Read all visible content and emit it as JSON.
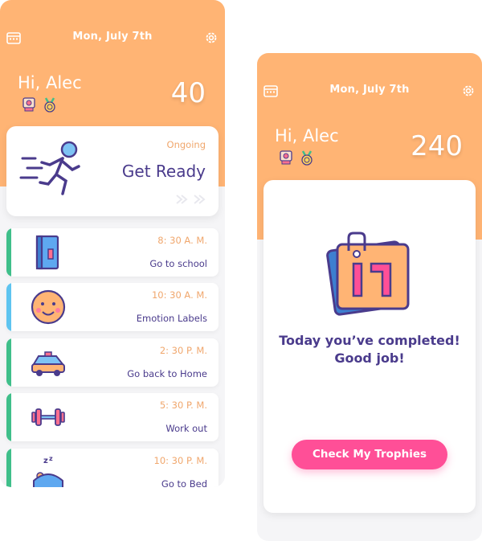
{
  "left_screen": {
    "date": "Mon, July 7th",
    "greeting": "Hi, Alec",
    "points": "40",
    "current_card": {
      "status": "Ongoing",
      "title": "Get Ready"
    },
    "tasks": [
      {
        "time": "8: 30 A. M.",
        "title": "Go to school",
        "icon": "book-icon",
        "stripe": "#3fbf8a"
      },
      {
        "time": "10: 30 A. M.",
        "title": "Emotion Labels",
        "icon": "smiley-face-icon",
        "stripe": "#5ec4f0"
      },
      {
        "time": "2: 30 P. M.",
        "title": "Go back to Home",
        "icon": "car-icon",
        "stripe": "#3fbf8a"
      },
      {
        "time": "5: 30 P. M.",
        "title": "Work out",
        "icon": "dumbbell-icon",
        "stripe": "#3fbf8a"
      },
      {
        "time": "10: 30 P. M.",
        "title": "Go to Bed",
        "icon": "sleeping-bed-icon",
        "stripe": "#3fbf8a"
      }
    ]
  },
  "right_screen": {
    "date": "Mon, July 7th",
    "greeting": "Hi, Alec",
    "points": "240",
    "message_line1": "Today you’ve completed!",
    "message_line2": "Good job!",
    "button_label": "Check My Trophies",
    "illustration": "calendar-17-icon"
  },
  "colors": {
    "header": "#ffb474",
    "accent_orange": "#f0a76d",
    "text_purple": "#4a3b8c",
    "cta_pink": "#ff4f97",
    "stripe_green": "#3fbf8a",
    "stripe_blue": "#5ec4f0"
  }
}
